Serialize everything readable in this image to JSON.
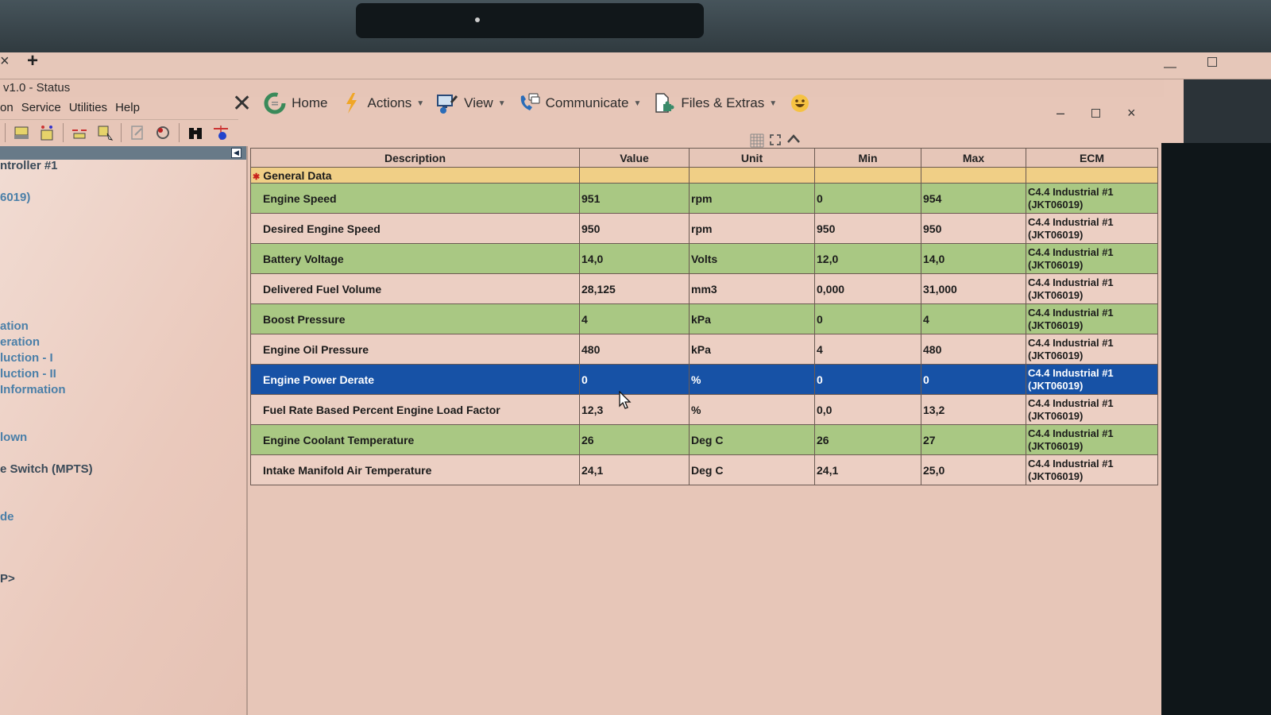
{
  "tabs": {
    "close_glyph": "×",
    "add_glyph": "+"
  },
  "window": {
    "title": "v1.0 - Status",
    "controls": {
      "minimize": "–",
      "close": "×"
    }
  },
  "menu": [
    "on",
    "Service",
    "Utilities",
    "Help"
  ],
  "ribbon": {
    "close_glyph": "✕",
    "buttons": [
      {
        "label": "Home",
        "icon": "home-refresh-icon",
        "has_dropdown": false
      },
      {
        "label": "Actions",
        "icon": "lightning-icon",
        "has_dropdown": true
      },
      {
        "label": "View",
        "icon": "monitor-icon",
        "has_dropdown": true
      },
      {
        "label": "Communicate",
        "icon": "phone-chat-icon",
        "has_dropdown": true
      },
      {
        "label": "Files & Extras",
        "icon": "file-puzzle-icon",
        "has_dropdown": true
      }
    ],
    "feedback_icon": "smiley-icon"
  },
  "toolbar_icons": [
    "ecm-summary-icon",
    "status-icon",
    "connect-icon",
    "config-icon",
    "edit-icon",
    "diagnostic-icon",
    "binoculars-icon",
    "wiring-icon"
  ],
  "sidebar": {
    "collapse_glyph": "◀",
    "items": [
      {
        "label": "ntroller #1",
        "style": "dark"
      },
      {
        "label": "6019)",
        "style": "blue"
      },
      {
        "label": "ation",
        "style": "blue"
      },
      {
        "label": "eration",
        "style": "blue"
      },
      {
        "label": "luction - I",
        "style": "blue"
      },
      {
        "label": "luction - II",
        "style": "blue"
      },
      {
        "label": "Information",
        "style": "blue"
      },
      {
        "label": "lown",
        "style": "blue"
      },
      {
        "label": "e Switch (MPTS)",
        "style": "dark"
      },
      {
        "label": "de",
        "style": "blue"
      },
      {
        "label": "P>",
        "style": "dark"
      }
    ]
  },
  "table": {
    "columns": [
      "Description",
      "Value",
      "Unit",
      "Min",
      "Max",
      "ECM"
    ],
    "group": {
      "marker": "✱",
      "label": "General Data"
    },
    "rows": [
      {
        "description": "Engine Speed",
        "value": "951",
        "unit": "rpm",
        "min": "0",
        "max": "954",
        "ecm_line1": "C4.4 Industrial #1",
        "ecm_line2": "(JKT06019)",
        "style": "green"
      },
      {
        "description": "Desired Engine Speed",
        "value": "950",
        "unit": "rpm",
        "min": "950",
        "max": "950",
        "ecm_line1": "C4.4 Industrial #1",
        "ecm_line2": "(JKT06019)",
        "style": "pink"
      },
      {
        "description": "Battery Voltage",
        "value": "14,0",
        "unit": "Volts",
        "min": "12,0",
        "max": "14,0",
        "ecm_line1": "C4.4 Industrial #1",
        "ecm_line2": "(JKT06019)",
        "style": "green"
      },
      {
        "description": "Delivered Fuel Volume",
        "value": "28,125",
        "unit": "mm3",
        "min": "0,000",
        "max": "31,000",
        "ecm_line1": "C4.4 Industrial #1",
        "ecm_line2": "(JKT06019)",
        "style": "pink"
      },
      {
        "description": "Boost Pressure",
        "value": "4",
        "unit": "kPa",
        "min": "0",
        "max": "4",
        "ecm_line1": "C4.4 Industrial #1",
        "ecm_line2": "(JKT06019)",
        "style": "green"
      },
      {
        "description": "Engine Oil Pressure",
        "value": "480",
        "unit": "kPa",
        "min": "4",
        "max": "480",
        "ecm_line1": "C4.4 Industrial #1",
        "ecm_line2": "(JKT06019)",
        "style": "pink"
      },
      {
        "description": "Engine Power Derate",
        "value": "0",
        "unit": "%",
        "min": "0",
        "max": "0",
        "ecm_line1": "C4.4 Industrial #1",
        "ecm_line2": "(JKT06019)",
        "style": "selected"
      },
      {
        "description": "Fuel Rate Based Percent Engine Load Factor",
        "value": "12,3",
        "unit": "%",
        "min": "0,0",
        "max": "13,2",
        "ecm_line1": "C4.4 Industrial #1",
        "ecm_line2": "(JKT06019)",
        "style": "pink"
      },
      {
        "description": "Engine Coolant Temperature",
        "value": "26",
        "unit": "Deg C",
        "min": "26",
        "max": "27",
        "ecm_line1": "C4.4 Industrial #1",
        "ecm_line2": "(JKT06019)",
        "style": "green"
      },
      {
        "description": "Intake Manifold Air Temperature",
        "value": "24,1",
        "unit": "Deg C",
        "min": "24,1",
        "max": "25,0",
        "ecm_line1": "C4.4 Industrial #1",
        "ecm_line2": "(JKT06019)",
        "style": "pink"
      }
    ]
  },
  "colors": {
    "row_green": "#a9c883",
    "row_pink": "#eccfc3",
    "row_selected": "#1752a6",
    "group_header": "#f0cf86"
  }
}
